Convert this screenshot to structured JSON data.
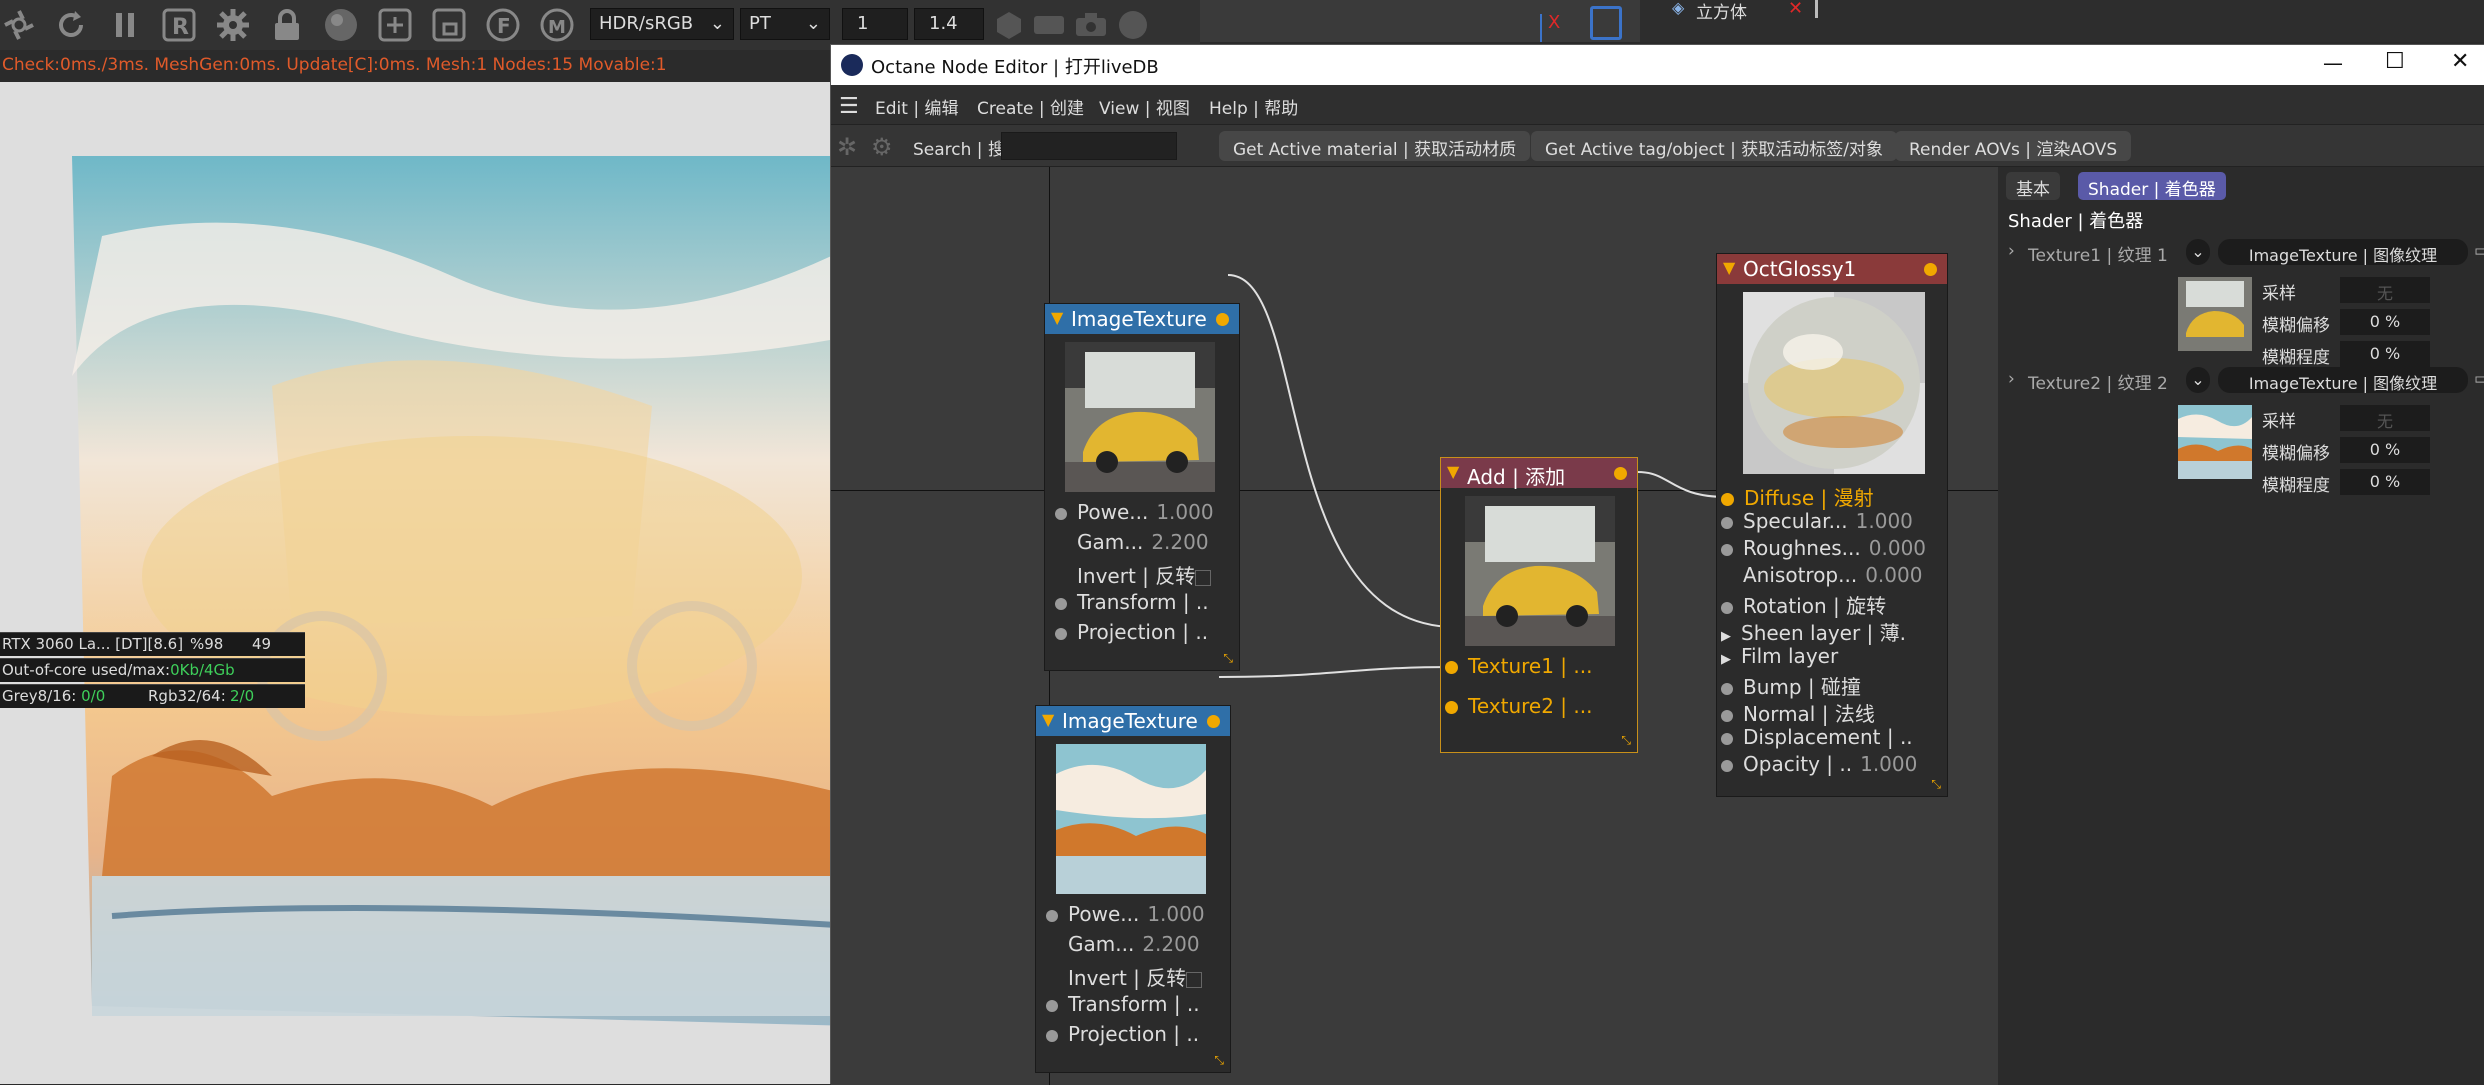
{
  "toolbar": {
    "icons": [
      "octane-logo-icon",
      "refresh-icon",
      "pause-icon",
      "r-icon",
      "gear-icon",
      "lock-icon",
      "sphere-icon",
      "add-region-icon",
      "region-icon",
      "f-icon",
      "m-icon"
    ],
    "color_mode": "HDR/sRGB",
    "kernel": "PT",
    "value1": "1",
    "value2": "1.4"
  },
  "stats": {
    "line": "Check:0ms./3ms. MeshGen:0ms. Update[C]:0ms. Mesh:1 Nodes:15 Movable:1"
  },
  "viewport": {
    "gpu_line": "RTX 3060 La... [DT][8.6]",
    "gpu_pct": "%98",
    "gpu_num": "49",
    "outofcore_label": "Out-of-core used/max:",
    "outofcore_value": "0Kb/4Gb",
    "grey_label": "Grey8/16:",
    "grey_value": "0/0",
    "rgb_label": "Rgb32/64:",
    "rgb_value": "2/0"
  },
  "topright": {
    "object_label": "立方体",
    "axis_x": "X"
  },
  "editor": {
    "title": "Octane Node Editor | 打开liveDB",
    "window_controls": {
      "minimize": "—",
      "maximize": "☐",
      "close": "✕"
    },
    "menu": [
      "Edit | 编辑",
      "Create | 创建",
      "View | 视图",
      "Help | 帮助"
    ],
    "search_label": "Search | 搜",
    "actions": [
      "Get Active material | 获取活动材质",
      "Get Active tag/object | 获取活动标签/对象",
      "Render AOVs | 渲染AOVS"
    ]
  },
  "nodes": {
    "tex1": {
      "title": "ImageTexture",
      "rows": [
        {
          "label": "Powe...",
          "value": "1.000"
        },
        {
          "label": "Gam...",
          "value": "2.200"
        },
        {
          "label": "Invert | 反转",
          "value": ""
        },
        {
          "label": "Transform | ..",
          "value": ""
        },
        {
          "label": "Projection | ..",
          "value": ""
        }
      ]
    },
    "tex2": {
      "title": "ImageTexture",
      "rows": [
        {
          "label": "Powe...",
          "value": "1.000"
        },
        {
          "label": "Gam...",
          "value": "2.200"
        },
        {
          "label": "Invert | 反转",
          "value": ""
        },
        {
          "label": "Transform | ..",
          "value": ""
        },
        {
          "label": "Projection | ..",
          "value": ""
        }
      ]
    },
    "add": {
      "title": "Add | 添加",
      "rows": [
        {
          "label": "Texture1 | ...",
          "value": ""
        },
        {
          "label": "Texture2 | ...",
          "value": ""
        }
      ]
    },
    "glossy": {
      "title": "OctGlossy1",
      "rows": [
        {
          "label": "Diffuse | 漫射",
          "value": ""
        },
        {
          "label": "Specular...",
          "value": "1.000"
        },
        {
          "label": "Roughnes...",
          "value": "0.000"
        },
        {
          "label": "Anisotrop...",
          "value": "0.000"
        },
        {
          "label": "Rotation | 旋转",
          "value": ""
        },
        {
          "label": "Sheen layer | 薄.",
          "value": ""
        },
        {
          "label": "Film layer",
          "value": ""
        },
        {
          "label": "Bump | 碰撞",
          "value": ""
        },
        {
          "label": "Normal | 法线",
          "value": ""
        },
        {
          "label": "Displacement | ..",
          "value": ""
        },
        {
          "label": "Opacity | ..",
          "value": "1.000"
        }
      ]
    }
  },
  "inspector": {
    "tabs": [
      "基本",
      "Shader | 着色器"
    ],
    "heading": "Shader | 着色器",
    "texture1": {
      "label": "Texture1 | 纹理 1",
      "type": "ImageTexture | 图像纹理",
      "sampling_label": "采样",
      "sampling_value": "无",
      "blur_offset_label": "模糊偏移",
      "blur_offset_value": "0 %",
      "blur_amount_label": "模糊程度",
      "blur_amount_value": "0 %"
    },
    "texture2": {
      "label": "Texture2 | 纹理 2",
      "type": "ImageTexture | 图像纹理",
      "sampling_label": "采样",
      "sampling_value": "无",
      "blur_offset_label": "模糊偏移",
      "blur_offset_value": "0 %",
      "blur_amount_label": "模糊程度",
      "blur_amount_value": "0 %"
    }
  },
  "colors": {
    "node_header_blue": "#2f6fa8",
    "node_header_red": "#8a3a3a",
    "port_orange": "#f0a800",
    "accent_purple": "#5a5aa8",
    "stats_orange": "#e05a2a"
  }
}
